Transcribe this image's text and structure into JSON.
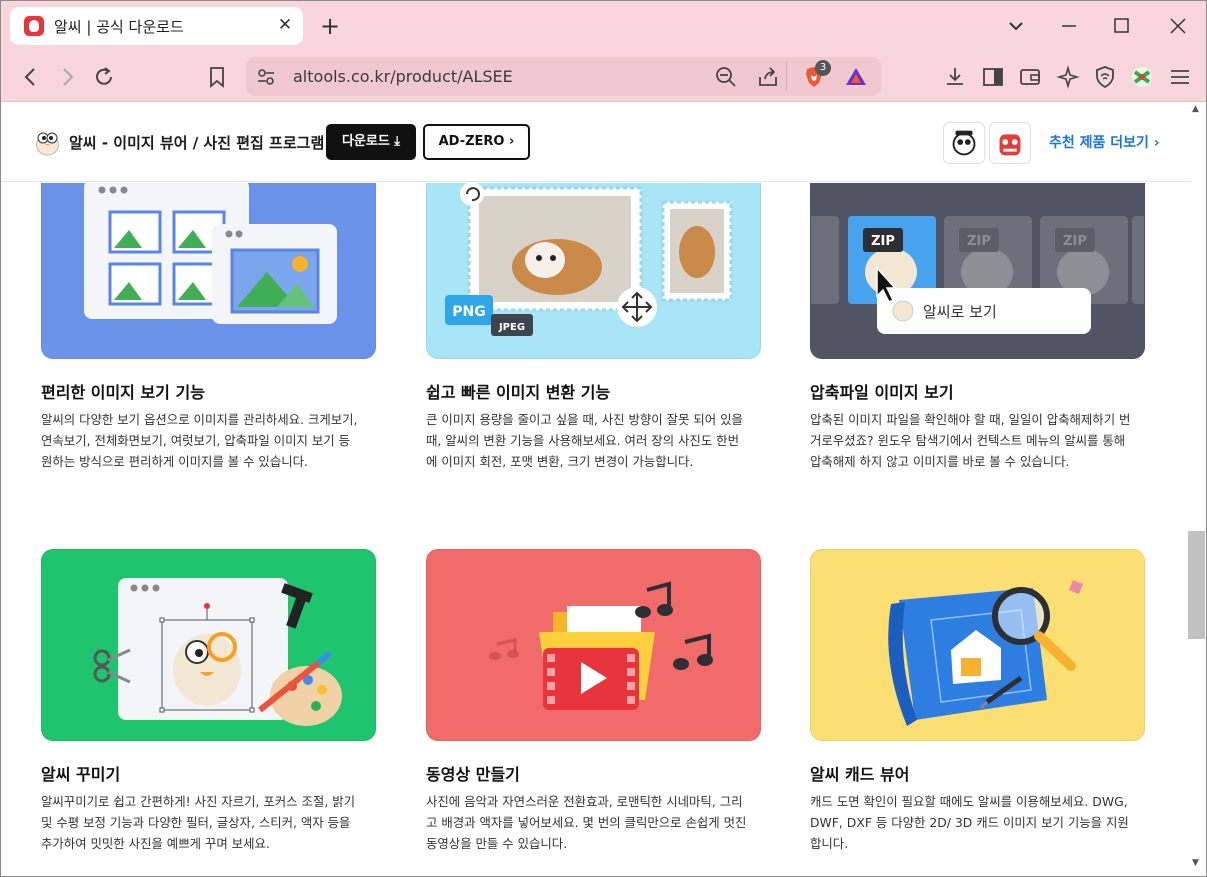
{
  "browser": {
    "tab_title": "알씨 | 공식 다운로드",
    "url": "altools.co.kr/product/ALSEE",
    "brave_badge": "3"
  },
  "site": {
    "title": "알씨 - 이미지 뷰어 / 사진 편집 프로그램",
    "download_label": "다운로드",
    "adzero_label": "AD-ZERO",
    "more_products_label": "추천 제품 더보기"
  },
  "features": [
    {
      "title": "편리한 이미지 보기 기능",
      "desc": [
        "알씨의 다양한 보기 옵션으로 이미지를 관리하세요. 크게보기,",
        "연속보기, 전체화면보기, 여럿보기, 압축파일 이미지 보기 등",
        "원하는 방식으로 편리하게 이미지를 볼 수 있습니다."
      ]
    },
    {
      "title": "쉽고 빠른 이미지 변환 기능",
      "desc": [
        "큰 이미지 용량을 줄이고 싶을 때, 사진 방향이 잘못 되어 있을",
        "때, 알씨의 변환 기능을 사용해보세요. 여러 장의 사진도 한번",
        "에 이미지 회전, 포맷 변환, 크기 변경이 가능합니다."
      ],
      "badges": [
        "PNG",
        "JPEG"
      ]
    },
    {
      "title": "압축파일 이미지 보기",
      "desc": [
        "압축된 이미지 파일을 확인해야 할 때, 일일이 압축해제하기 번",
        "거로우셨죠? 윈도우 탐색기에서 컨텍스트 메뉴의 알씨를 통해",
        "압축해제 하지 않고 이미지를 바로 볼 수 있습니다."
      ],
      "zip_label": "ZIP",
      "popup_label": "알씨로 보기"
    },
    {
      "title": "알씨 꾸미기",
      "desc": [
        "알씨꾸미기로 쉽고 간편하게! 사진 자르기, 포커스 조절, 밝기",
        "및 수평 보정 기능과 다양한 필터, 글상자, 스티커, 액자 등을",
        "추가하여 밋밋한 사진을 예쁘게 꾸며 보세요."
      ]
    },
    {
      "title": "동영상 만들기",
      "desc": [
        "사진에 음악과 자연스러운 전환효과, 로맨틱한 시네마틱, 그리",
        "고 배경과 액자를 넣어보세요. 몇 번의 클릭만으로 손쉽게 멋진",
        "동영상을 만들 수 있습니다."
      ]
    },
    {
      "title": "알씨 캐드 뷰어",
      "desc": [
        "캐드 도면 확인이 필요할 때에도 알씨를 이용해보세요. DWG,",
        "DWF, DXF 등 다양한 2D/ 3D 캐드 이미지 보기 기능을 지원",
        "합니다."
      ]
    }
  ],
  "colors": {
    "card1_bg": "#6b93ea",
    "card2_bg": "#a8e6f7",
    "card3_bg": "#4f5562",
    "card4_bg": "#1fc46f",
    "card5_bg": "#f26b6b",
    "card6_bg": "#fbdf72",
    "link": "#1a73e8"
  }
}
